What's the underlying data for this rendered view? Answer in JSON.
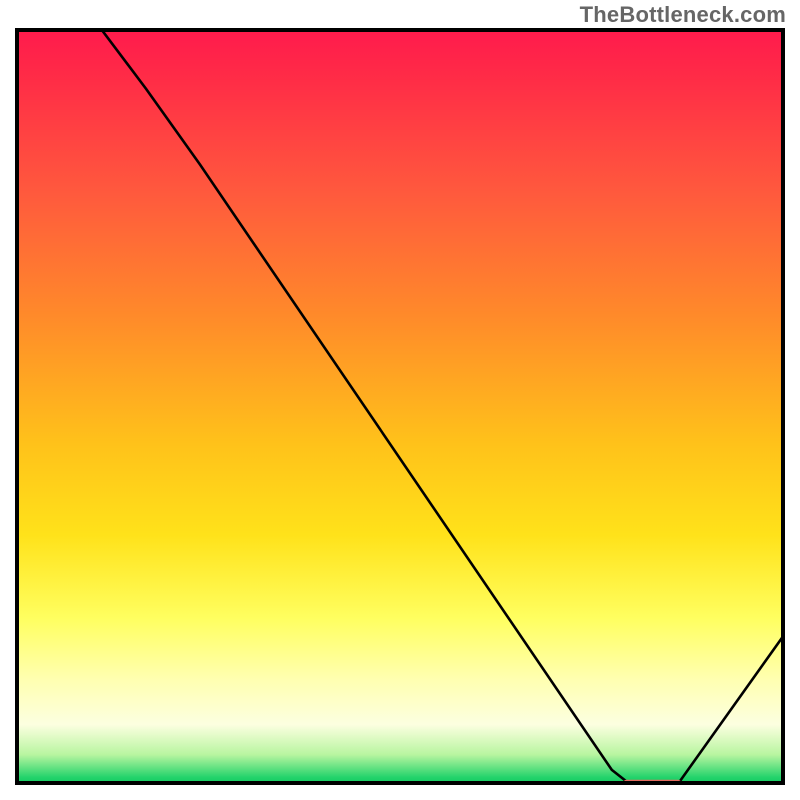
{
  "attribution": "TheBottleneck.com",
  "colors": {
    "line": "#000000",
    "marker": "#e46a5e",
    "axis": "#000000"
  },
  "chart_data": {
    "type": "line",
    "title": "",
    "xlabel": "",
    "ylabel": "",
    "xlim": [
      0,
      100
    ],
    "ylim": [
      0,
      100
    ],
    "x": [
      0,
      17,
      24,
      77.5,
      80,
      86,
      100
    ],
    "values": [
      115,
      92,
      82,
      2,
      0,
      0,
      20
    ],
    "marker": {
      "x_start": 79,
      "x_end": 86.5,
      "y": 0.3
    },
    "notes": "y axis represents bottleneck percentage (0 at bottom = optimal/green, 100 at top = severe/red); x axis is an unlabeled parameter sweep. Line originates above the visible ylim (off-chart) and descends to a flat minimum near x=80–86, then rises."
  }
}
